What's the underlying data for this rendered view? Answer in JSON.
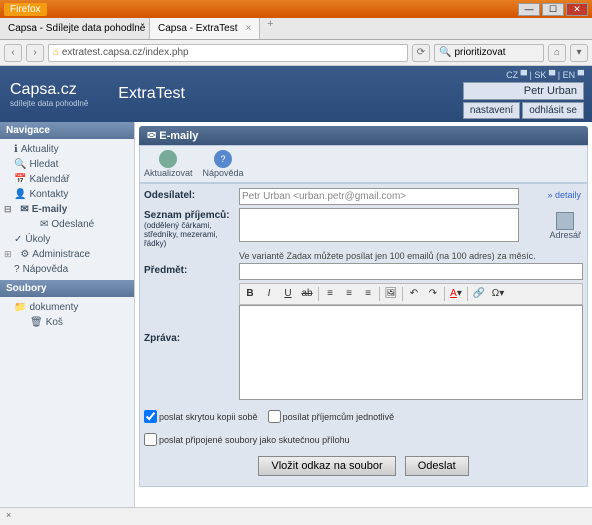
{
  "browser": {
    "name": "Firefox",
    "tabs": [
      {
        "title": "Capsa - Sdílejte data pohodlně | Vlast..."
      },
      {
        "title": "Capsa - ExtraTest"
      }
    ],
    "url": "extratest.capsa.cz/index.php",
    "search_placeholder": "prioritizovat"
  },
  "header": {
    "logo": "Capsa.cz",
    "tagline": "sdílejte data pohodlně",
    "app_title": "ExtraTest",
    "langs": "CZ ▀ | SK ▀ | EN ▀",
    "user": "Petr Urban",
    "settings": "nastavení",
    "logout": "odhlásit se"
  },
  "sidebar": {
    "nav_title": "Navigace",
    "items": [
      {
        "label": "Aktuality"
      },
      {
        "label": "Hledat"
      },
      {
        "label": "Kalendář"
      },
      {
        "label": "Kontakty"
      },
      {
        "label": "E-maily"
      },
      {
        "label": "Odeslané"
      },
      {
        "label": "Úkoly"
      },
      {
        "label": "Administrace"
      },
      {
        "label": "Nápověda"
      }
    ],
    "files_title": "Soubory",
    "files": [
      {
        "label": "dokumenty"
      },
      {
        "label": "Koš"
      }
    ]
  },
  "panel": {
    "title": "E-maily",
    "tb_refresh": "Aktualizovat",
    "tb_help": "Nápověda"
  },
  "form": {
    "sender_label": "Odesílatel:",
    "sender_value": "Petr Urban <urban.petr@gmail.com>",
    "recipients_label": "Seznam příjemců:",
    "recipients_hint": "(oddělený čárkami, středníky, mezerami, řádky)",
    "limit_note": "Ve variantě Zadax můžete posílat jen 100 emailů (na 100 adres) za měsíc.",
    "subject_label": "Předmět:",
    "message_label": "Zpráva:",
    "details": "» detaily",
    "addressbook": "Adresář"
  },
  "checks": {
    "c1": "poslat skrytou kopii sobě",
    "c2": "posílat příjemcům jednotlivě",
    "c3": "poslat připojené soubory jako skutečnou přílohu"
  },
  "actions": {
    "insert_link": "Vložit odkaz na soubor",
    "send": "Odeslat"
  },
  "statusbar": "×"
}
